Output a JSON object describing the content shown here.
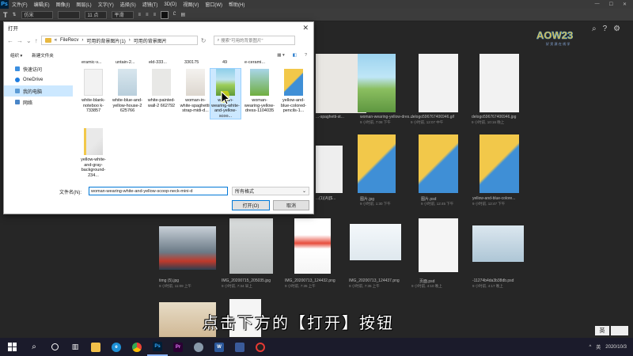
{
  "menubar": {
    "app": "Ps",
    "items": [
      "文件(F)",
      "编辑(E)",
      "图像(I)",
      "图层(L)",
      "文字(Y)",
      "选择(S)",
      "滤镜(T)",
      "3D(D)",
      "视图(V)",
      "窗口(W)",
      "帮助(H)"
    ]
  },
  "optbar": {
    "font": "仿宋",
    "size": "11 点",
    "aa": "平滑"
  },
  "dialog": {
    "title": "打开",
    "breadcrumb": [
      "FileRecv",
      "可用的背景图片(1)",
      "可用的背景图片"
    ],
    "search_placeholder": "搜索\"可用的背景图片\"",
    "organize": "组织 ▾",
    "new_folder": "新建文件夹",
    "nav": [
      "快速访问",
      "OneDrive",
      "我的电脑",
      "网络"
    ],
    "top_row": [
      "eramic-v...",
      "untain-2...",
      "eld-333...",
      "330175",
      "49",
      "e-cerami..."
    ],
    "files": [
      "white-blank-noteboo k-733857",
      "white-blue-and-yellow-house-2 625766",
      "white-painted-wall-2 662792",
      "woman-in-white-spaghetti-strap-midi-d...",
      "woman-wearing-white-and-yellow-scoo...",
      "woman-wearing-yellow-dress-1104035",
      "yellow-and-blue-colored-pencils-1...",
      "yellow-white-and-gray-background-234..."
    ],
    "filename_label": "文件名(N):",
    "filename_value": "woman-wearing-white-and-yellow-scoop-neck-mini-d",
    "filetype": "所有格式",
    "open_btn": "打开(O)",
    "cancel_btn": "取消"
  },
  "thumbs": [
    {
      "name": "...-spaghetti-st...",
      "sub": ""
    },
    {
      "name": "woman-wearing-yellow-dres...",
      "sub": "9 小时前, 7:08 下午"
    },
    {
      "name": "delogo596767406946.gif",
      "sub": "9 小时前, 12:07 中午"
    },
    {
      "name": "delogo596767406946.jpg",
      "sub": "9 小时前, 10:16 晚上"
    },
    {
      "name": "...(1)(A)[$...",
      "sub": ""
    },
    {
      "name": "图片.jpg",
      "sub": "9 小时前, 1:30 下午"
    },
    {
      "name": "图片.psd",
      "sub": "9 小时前, 12:45 下午"
    },
    {
      "name": "yellow-and-blue-colore...",
      "sub": "9 小时前, 12:47 下午"
    },
    {
      "name": "timg (5).jpg",
      "sub": "9 小时前, 11:09 上午"
    },
    {
      "name": "IMG_20200715_205035.jpg",
      "sub": "9 小时前, 7:34 早上"
    },
    {
      "name": "IMG_20200713_124432.png",
      "sub": "9 小时前, 7:35 上午"
    },
    {
      "name": "IMG_20200713_124437.png",
      "sub": "9 小时前, 7:35 上午"
    },
    {
      "name": "页面.psd",
      "sub": "9 小时前, 4:10 晚上"
    },
    {
      "name": "-11274b4da3b38db.psd",
      "sub": "9 小时前, 4:17 晚上"
    }
  ],
  "caption": "点击下方的【打开】按钮",
  "taskbar": {
    "ime": "英",
    "date": "2020/10/3",
    "lang": "英"
  },
  "colors": {
    "ps_bg": "#262626",
    "accent": "#0078d7",
    "selection": "#cce8ff"
  }
}
